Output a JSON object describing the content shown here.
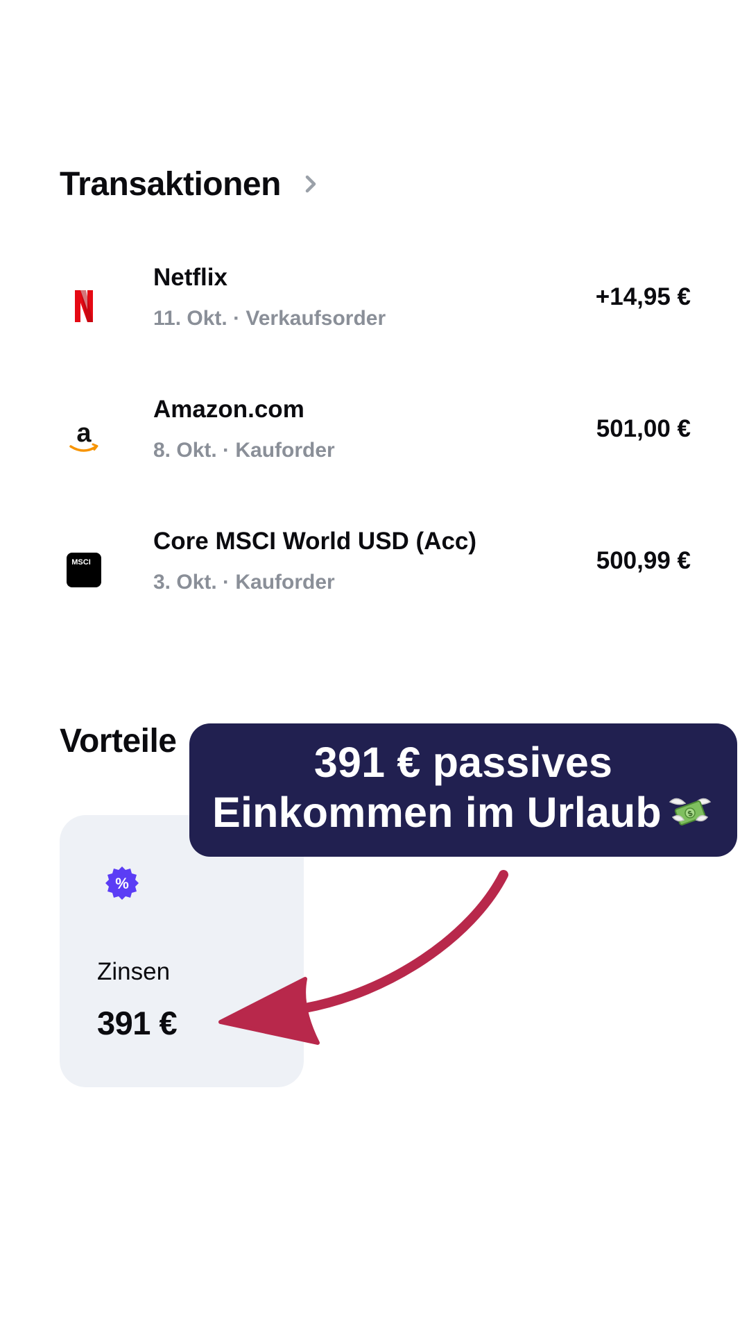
{
  "transactions": {
    "title": "Transaktionen",
    "items": [
      {
        "name": "Netflix",
        "meta": "11. Okt. · Verkaufsorder",
        "amount": "+14,95 €",
        "icon": "netflix-logo",
        "icon_text": "N",
        "icon_color": "#e50914"
      },
      {
        "name": "Amazon.com",
        "meta": "8. Okt. · Kauforder",
        "amount": "501,00 €",
        "icon": "amazon-logo",
        "icon_text": "a",
        "icon_color": "#111111"
      },
      {
        "name": "Core MSCI World USD (Acc)",
        "meta": "3. Okt. · Kauforder",
        "amount": "500,99 €",
        "icon": "msci-logo",
        "icon_text": "MSCI",
        "icon_color": "#000000"
      }
    ]
  },
  "benefits": {
    "title": "Vorteile",
    "card": {
      "label": "Zinsen",
      "value": "391 €",
      "icon": "percent-badge-icon",
      "icon_color": "#5b3df5"
    }
  },
  "overlay": {
    "line1": "391 € passives",
    "line2": "Einkommen im Urlaub",
    "emoji": "money-with-wings",
    "background": "#212050",
    "arrow_color": "#b8284b"
  },
  "colors": {
    "text_primary": "#0b0b0f",
    "text_secondary": "#8a8f98",
    "card_background": "#eef1f6"
  }
}
